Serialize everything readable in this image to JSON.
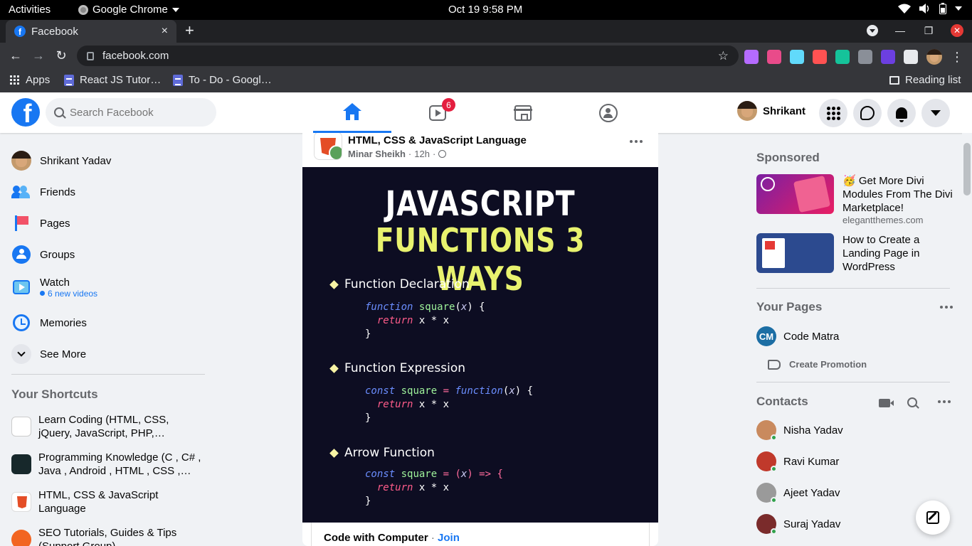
{
  "system_bar": {
    "activities": "Activities",
    "app_name": "Google Chrome",
    "clock": "Oct 19  9:58 PM"
  },
  "browser": {
    "tab_title": "Facebook",
    "tab_close": "×",
    "new_tab": "+",
    "url": "facebook.com",
    "bookmarks": {
      "apps": "Apps",
      "items": [
        "React JS Tutor…",
        "To - Do - Googl…"
      ],
      "reading_list": "Reading list"
    },
    "extension_colors": [
      "#b56bff",
      "#e94b8a",
      "#61dafb",
      "#ff5252",
      "#15c39a",
      "#8a8f98",
      "#6c3fe0",
      "#e8eaed"
    ]
  },
  "fb_header": {
    "logo": "f",
    "search_placeholder": "Search Facebook",
    "watch_badge": "6",
    "profile_name": "Shrikant",
    "active_tab": "home"
  },
  "left_nav": {
    "items": [
      {
        "label": "Shrikant Yadav"
      },
      {
        "label": "Friends"
      },
      {
        "label": "Pages"
      },
      {
        "label": "Groups"
      },
      {
        "label": "Watch",
        "sub": "6 new videos"
      },
      {
        "label": "Memories"
      },
      {
        "label": "See More"
      }
    ],
    "shortcuts_title": "Your Shortcuts",
    "shortcuts": [
      {
        "label": "Learn Coding (HTML, CSS, jQuery, JavaScript, PHP,…"
      },
      {
        "label": "Programming Knowledge (C , C# , Java , Android , HTML , CSS ,…"
      },
      {
        "label": "HTML, CSS & JavaScript Language"
      },
      {
        "label": "SEO Tutorials, Guides & Tips (Support Group)"
      }
    ]
  },
  "post": {
    "group_name": "HTML, CSS & JavaScript Language",
    "author": "Minar Sheikh",
    "time": "12h",
    "separator": "·",
    "image": {
      "headline1": "JAVASCRIPT",
      "headline2": "FUNCTIONS 3 WAYS",
      "sections": [
        {
          "title": "Function Declaration"
        },
        {
          "title": "Function Expression"
        },
        {
          "title": "Arrow Function"
        }
      ],
      "code": {
        "decl_line1": [
          "function",
          " ",
          "square",
          "(",
          "x",
          ") {"
        ],
        "return_kw": "return",
        "return_expr": " x * x",
        "close_brace": "}",
        "expr_line1": [
          "const",
          " ",
          "square",
          " = ",
          "function",
          "(",
          "x",
          ") {"
        ],
        "arrow_line1": [
          "const",
          " ",
          "square",
          " = (",
          "x",
          ") => {"
        ]
      }
    },
    "footer_group": "Code with Computer",
    "footer_dot": "·",
    "footer_join": "Join"
  },
  "right_col": {
    "sponsored_title": "Sponsored",
    "ads": [
      {
        "text": "🥳 Get More Divi Modules From The Divi Marketplace!",
        "domain": "elegantthemes.com"
      },
      {
        "text": "How to Create a Landing Page in WordPress",
        "domain": ""
      }
    ],
    "your_pages_title": "Your Pages",
    "page_name": "Code Matra",
    "page_logo": "CM",
    "create_promotion": "Create Promotion",
    "contacts_title": "Contacts",
    "contacts": [
      {
        "name": "Nisha Yadav",
        "color": "#c98a5e"
      },
      {
        "name": "Ravi Kumar",
        "color": "#c0392b"
      },
      {
        "name": "Ajeet Yadav",
        "color": "#9a9a9a"
      },
      {
        "name": "Suraj Yadav",
        "color": "#7a2b2b"
      }
    ]
  }
}
